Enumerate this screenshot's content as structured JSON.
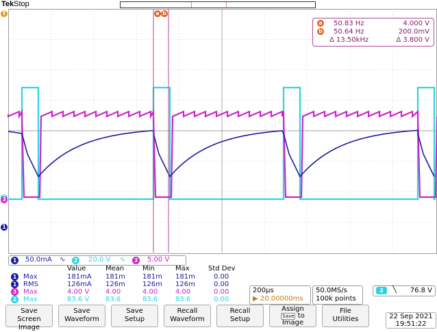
{
  "header": {
    "brand": "Tek",
    "state": "Stop"
  },
  "colors": {
    "ch1": "#1a1a9e",
    "ch2": "#2bd4e0",
    "ch3": "#cc22cc",
    "cursor": "#e0601a",
    "grid": "#b0b0b0"
  },
  "cursor_readout": {
    "a_label": "a",
    "b_label": "b",
    "a_freq": "50.83 Hz",
    "a_value": "4.000 V",
    "b_freq": "50.64 Hz",
    "b_value": "200.0mV",
    "delta_freq": "Δ 13.50kHz",
    "delta_value": "Δ 3.800 V"
  },
  "channels": [
    {
      "num": "1",
      "scale": "50.0mA",
      "coupling": "∿"
    },
    {
      "num": "2",
      "scale": "20.0 V",
      "coupling": "∿"
    },
    {
      "num": "3",
      "scale": "5.00 V",
      "coupling": ""
    }
  ],
  "ground_markers": {
    "ch2": "2",
    "ch3": "3",
    "ch1": "1",
    "trigger": "T"
  },
  "measurements": {
    "headers": [
      "Value",
      "Mean",
      "Min",
      "Max",
      "Std Dev"
    ],
    "rows": [
      {
        "ch": "1",
        "name": "Max",
        "value": "181mA",
        "mean": "181m",
        "min": "181m",
        "max": "181m",
        "std": "0.00"
      },
      {
        "ch": "1",
        "name": "RMS",
        "value": "126mA",
        "mean": "126m",
        "min": "126m",
        "max": "126m",
        "std": "0.00"
      },
      {
        "ch": "3",
        "name": "Max",
        "value": "4.00 V",
        "mean": "4.00",
        "min": "4.00",
        "max": "4.00",
        "std": "0.00"
      },
      {
        "ch": "2",
        "name": "Max",
        "value": "83.6 V",
        "mean": "83.6",
        "min": "83.6",
        "max": "83.6",
        "std": "0.00"
      }
    ]
  },
  "horizontal": {
    "scale": "200µs",
    "position": "▶ 20.00000ms"
  },
  "acquisition": {
    "rate": "50.0MS/s",
    "points": "100k points"
  },
  "trigger": {
    "source": "2",
    "slope": "╲",
    "level": "76.8 V"
  },
  "softkeys": [
    {
      "line1": "Save",
      "line2": "Screen Image"
    },
    {
      "line1": "Save",
      "line2": "Waveform"
    },
    {
      "line1": "Save",
      "line2": "Setup"
    },
    {
      "line1": "Recall",
      "line2": "Waveform"
    },
    {
      "line1": "Recall",
      "line2": "Setup"
    },
    {
      "line1": "Assign",
      "line2": "Save",
      "line3": "to",
      "line4": "Image"
    },
    {
      "line1": "File",
      "line2": "Utilities"
    }
  ],
  "datetime": {
    "date": "22 Sep  2021",
    "time": "19:51:22"
  }
}
